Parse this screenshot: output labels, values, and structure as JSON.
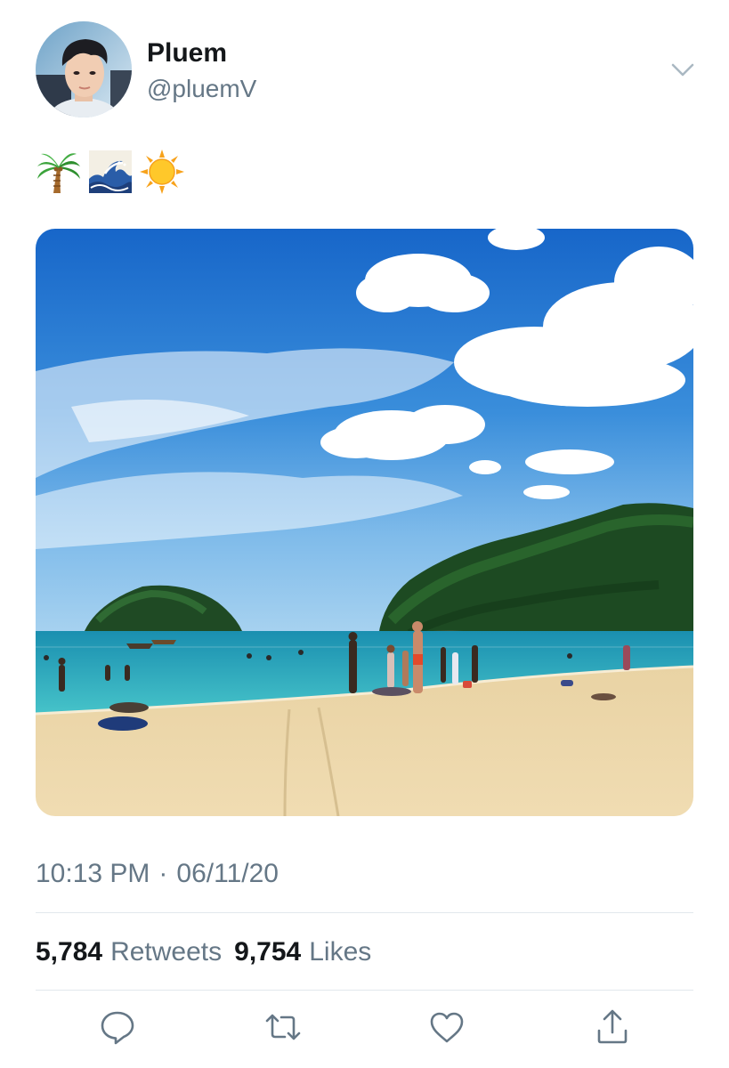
{
  "author": {
    "display_name": "Pluem",
    "handle": "@pluemV",
    "avatar_icon": "profile-photo"
  },
  "tweet": {
    "emojis": [
      "palm-tree-emoji",
      "water-wave-emoji",
      "sun-emoji"
    ],
    "media": {
      "type": "photo",
      "description_icon": "beach-photo"
    },
    "time": "10:13 PM",
    "separator": "·",
    "date": "06/11/20"
  },
  "stats": {
    "retweets_count": "5,784",
    "retweets_label": "Retweets",
    "likes_count": "9,754",
    "likes_label": "Likes"
  },
  "actions": {
    "reply_icon": "speech-bubble-icon",
    "retweet_icon": "retweet-icon",
    "like_icon": "heart-icon",
    "share_icon": "share-icon"
  },
  "colors": {
    "text_primary": "#14171a",
    "text_secondary": "#657786",
    "divider": "#e1e8ed",
    "icon": "#657786"
  }
}
